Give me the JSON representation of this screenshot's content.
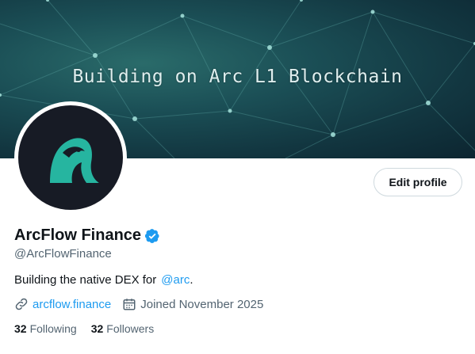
{
  "banner": {
    "text": "Building on Arc L1 Blockchain"
  },
  "profile": {
    "edit_button_label": "Edit profile",
    "display_name": "ArcFlow Finance",
    "handle": "@ArcFlowFinance",
    "bio_text": "Building the native DEX for",
    "bio_mention": "@arc",
    "bio_suffix": ".",
    "website": "arcflow.finance",
    "joined": "Joined November 2025",
    "following_count": "32",
    "following_label": "Following",
    "followers_count": "32",
    "followers_label": "Followers"
  },
  "icons": {
    "verified": "verified-badge-icon",
    "link": "link-icon",
    "calendar": "calendar-icon"
  },
  "colors": {
    "accent": "#1d9bf0",
    "avatar_bg": "#171b25",
    "logo": "#26b5a0",
    "text_primary": "#0f1419",
    "text_secondary": "#536471"
  }
}
